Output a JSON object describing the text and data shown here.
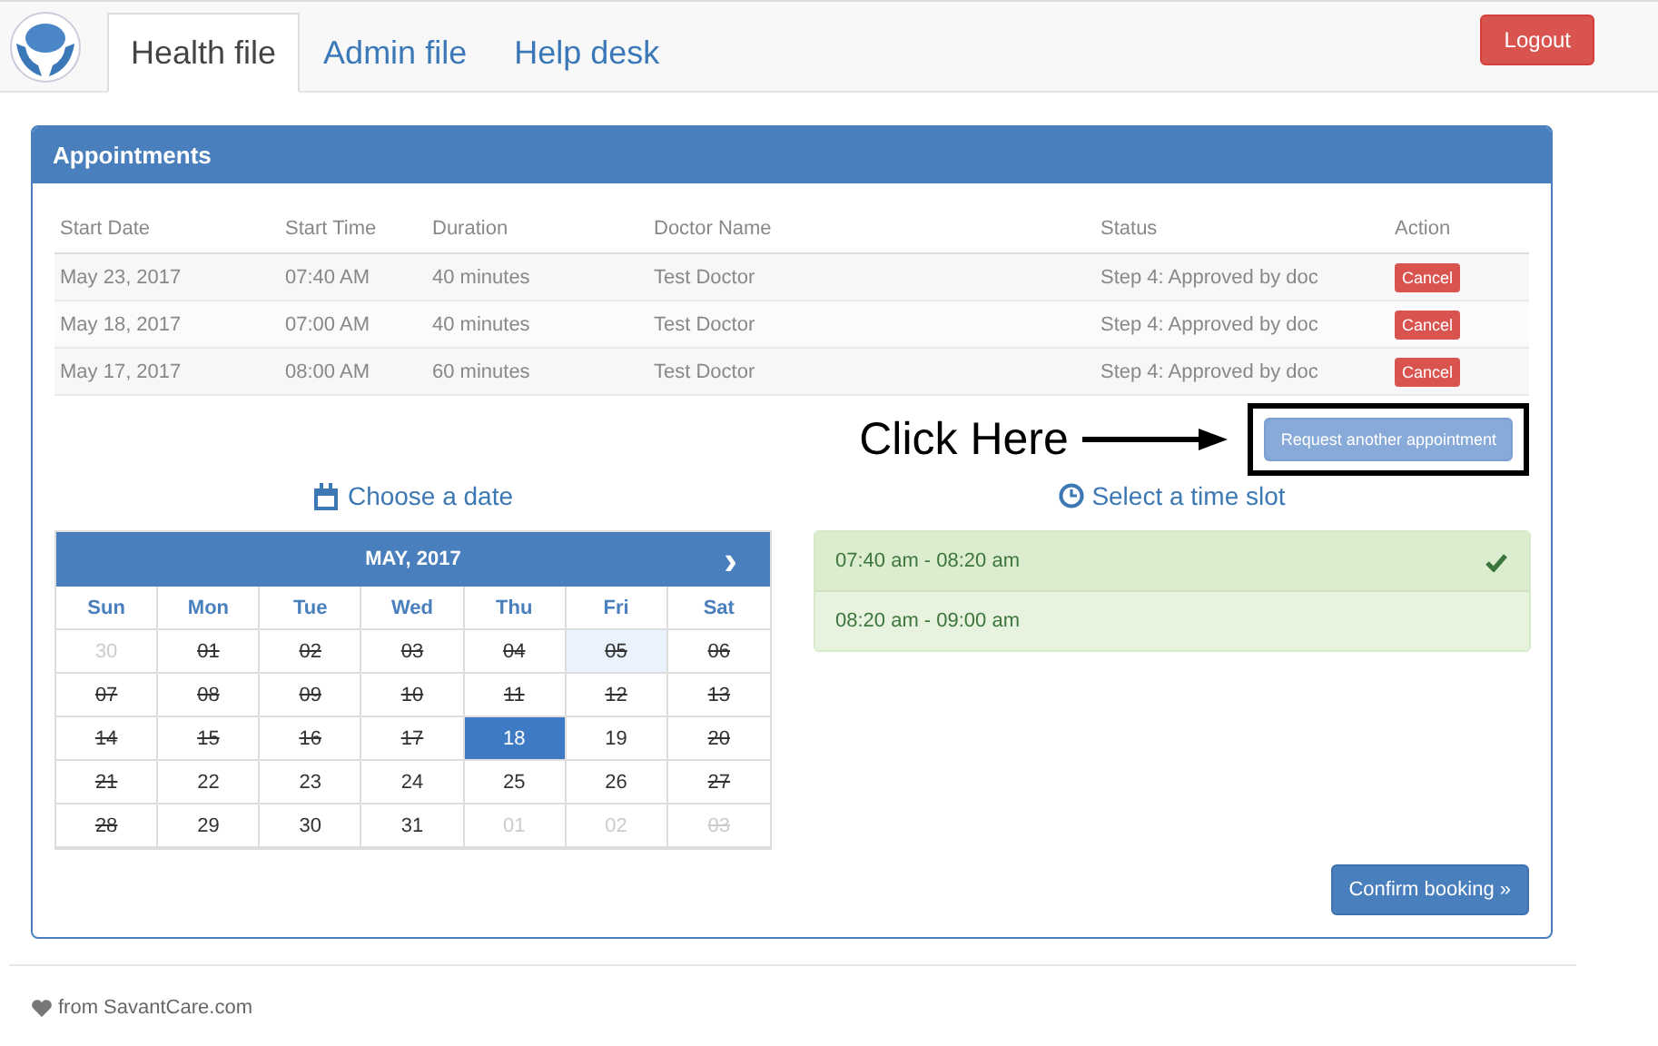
{
  "nav": {
    "tabs": [
      {
        "label": "Health file",
        "selected": true
      },
      {
        "label": "Admin file",
        "selected": false
      },
      {
        "label": "Help desk",
        "selected": false
      }
    ],
    "logout": "Logout"
  },
  "appointments": {
    "title": "Appointments",
    "columns": [
      "Start Date",
      "Start Time",
      "Duration",
      "Doctor Name",
      "Status",
      "Action"
    ],
    "rows": [
      {
        "cells": [
          "May 23, 2017",
          "07:40 AM",
          "40 minutes",
          "Test Doctor",
          "Step 4: Approved by doc"
        ],
        "action": "Cancel"
      },
      {
        "cells": [
          "May 18, 2017",
          "07:00 AM",
          "40 minutes",
          "Test Doctor",
          "Step 4: Approved by doc"
        ],
        "action": "Cancel"
      },
      {
        "cells": [
          "May 17, 2017",
          "08:00 AM",
          "60 minutes",
          "Test Doctor",
          "Step 4: Approved by doc"
        ],
        "action": "Cancel"
      }
    ],
    "annotation": "Click Here",
    "request_button": "Request another appointment",
    "date_heading": "Choose a date",
    "time_heading": "Select a time slot",
    "calendar": {
      "month": "MAY, 2017",
      "next": "›",
      "weekdays": [
        "Sun",
        "Mon",
        "Tue",
        "Wed",
        "Thu",
        "Fri",
        "Sat"
      ],
      "weeks": [
        [
          {
            "day": "30",
            "other_month": true,
            "disabled": false,
            "today": false,
            "selected": false
          },
          {
            "day": "01",
            "other_month": false,
            "disabled": true,
            "today": false,
            "selected": false
          },
          {
            "day": "02",
            "other_month": false,
            "disabled": true,
            "today": false,
            "selected": false
          },
          {
            "day": "03",
            "other_month": false,
            "disabled": true,
            "today": false,
            "selected": false
          },
          {
            "day": "04",
            "other_month": false,
            "disabled": true,
            "today": false,
            "selected": false
          },
          {
            "day": "05",
            "other_month": false,
            "disabled": true,
            "today": true,
            "selected": false
          },
          {
            "day": "06",
            "other_month": false,
            "disabled": true,
            "today": false,
            "selected": false
          }
        ],
        [
          {
            "day": "07",
            "other_month": false,
            "disabled": true,
            "today": false,
            "selected": false
          },
          {
            "day": "08",
            "other_month": false,
            "disabled": true,
            "today": false,
            "selected": false
          },
          {
            "day": "09",
            "other_month": false,
            "disabled": true,
            "today": false,
            "selected": false
          },
          {
            "day": "10",
            "other_month": false,
            "disabled": true,
            "today": false,
            "selected": false
          },
          {
            "day": "11",
            "other_month": false,
            "disabled": true,
            "today": false,
            "selected": false
          },
          {
            "day": "12",
            "other_month": false,
            "disabled": true,
            "today": false,
            "selected": false
          },
          {
            "day": "13",
            "other_month": false,
            "disabled": true,
            "today": false,
            "selected": false
          }
        ],
        [
          {
            "day": "14",
            "other_month": false,
            "disabled": true,
            "today": false,
            "selected": false
          },
          {
            "day": "15",
            "other_month": false,
            "disabled": true,
            "today": false,
            "selected": false
          },
          {
            "day": "16",
            "other_month": false,
            "disabled": true,
            "today": false,
            "selected": false
          },
          {
            "day": "17",
            "other_month": false,
            "disabled": true,
            "today": false,
            "selected": false
          },
          {
            "day": "18",
            "other_month": false,
            "disabled": false,
            "today": false,
            "selected": true
          },
          {
            "day": "19",
            "other_month": false,
            "disabled": false,
            "today": false,
            "selected": false
          },
          {
            "day": "20",
            "other_month": false,
            "disabled": true,
            "today": false,
            "selected": false
          }
        ],
        [
          {
            "day": "21",
            "other_month": false,
            "disabled": true,
            "today": false,
            "selected": false
          },
          {
            "day": "22",
            "other_month": false,
            "disabled": false,
            "today": false,
            "selected": false
          },
          {
            "day": "23",
            "other_month": false,
            "disabled": false,
            "today": false,
            "selected": false
          },
          {
            "day": "24",
            "other_month": false,
            "disabled": false,
            "today": false,
            "selected": false
          },
          {
            "day": "25",
            "other_month": false,
            "disabled": false,
            "today": false,
            "selected": false
          },
          {
            "day": "26",
            "other_month": false,
            "disabled": false,
            "today": false,
            "selected": false
          },
          {
            "day": "27",
            "other_month": false,
            "disabled": true,
            "today": false,
            "selected": false
          }
        ],
        [
          {
            "day": "28",
            "other_month": false,
            "disabled": true,
            "today": false,
            "selected": false
          },
          {
            "day": "29",
            "other_month": false,
            "disabled": false,
            "today": false,
            "selected": false
          },
          {
            "day": "30",
            "other_month": false,
            "disabled": false,
            "today": false,
            "selected": false
          },
          {
            "day": "31",
            "other_month": false,
            "disabled": false,
            "today": false,
            "selected": false
          },
          {
            "day": "01",
            "other_month": true,
            "disabled": false,
            "today": false,
            "selected": false
          },
          {
            "day": "02",
            "other_month": true,
            "disabled": false,
            "today": false,
            "selected": false
          },
          {
            "day": "03",
            "other_month": true,
            "disabled": true,
            "today": false,
            "selected": false
          }
        ]
      ]
    },
    "slots": [
      {
        "label": "07:40 am - 08:20 am",
        "selected": true
      },
      {
        "label": "08:20 am - 09:00 am",
        "selected": false
      }
    ],
    "confirm": "Confirm booking »"
  },
  "footer": "from SavantCare.com"
}
